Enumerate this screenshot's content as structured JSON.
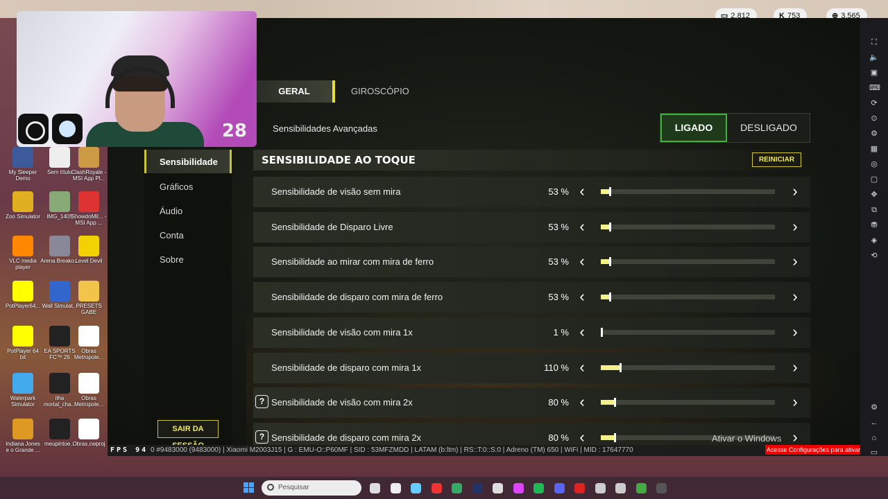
{
  "top_stats": [
    {
      "icon": "chat-icon",
      "value": "2.812"
    },
    {
      "icon": "kick-icon",
      "value": "753"
    },
    {
      "icon": "globe-icon",
      "value": "3.565"
    }
  ],
  "webcam": {
    "overlay_number": "28"
  },
  "desktop_icons": [
    {
      "label": "My Sleeper Demo"
    },
    {
      "label": "Sem título"
    },
    {
      "label": "ClashRoyale - MSI App Pl..."
    },
    {
      "label": "Zoo Simulator"
    },
    {
      "label": "IMG_1405"
    },
    {
      "label": "ShowdoMil... - MSI App ..."
    },
    {
      "label": "VLC media player"
    },
    {
      "label": "Arena Breako..."
    },
    {
      "label": "Level Devil"
    },
    {
      "label": "PotPlayer64..."
    },
    {
      "label": "Wall Simulat..."
    },
    {
      "label": "PRESETS GABE"
    },
    {
      "label": "PotPlayer 64 bit"
    },
    {
      "label": "EA SPORTS FC™ 26"
    },
    {
      "label": "Obras Metropole..."
    },
    {
      "label": "Waterpark Simulator"
    },
    {
      "label": "ilha mortal_cha..."
    },
    {
      "label": "Obras Metropole..."
    },
    {
      "label": "Indiana Jones e o Grande ..."
    },
    {
      "label": "meupintoe..."
    },
    {
      "label": "Obras.cwproj"
    }
  ],
  "tabs": {
    "active": "GERAL",
    "other": "GIROSCÓPIO"
  },
  "advanced": {
    "label": "Sensibilidades Avançadas",
    "on": "LIGADO",
    "off": "DESLIGADO"
  },
  "menu": {
    "items": [
      "Sensibilidade",
      "Gráficos",
      "Áudio",
      "Conta",
      "Sobre"
    ],
    "logout": "SAIR DA SESSÃO"
  },
  "section": {
    "title": "SENSIBILIDADE AO TOQUE",
    "reset": "REINICIAR"
  },
  "sensitivities": [
    {
      "label": "Sensibilidade de visão sem mira",
      "value": "53 %",
      "level": 0.05,
      "help": false
    },
    {
      "label": "Sensibilidade de Disparo Livre",
      "value": "53 %",
      "level": 0.05,
      "help": false
    },
    {
      "label": "Sensibilidade ao mirar com mira de ferro",
      "value": "53 %",
      "level": 0.05,
      "help": false
    },
    {
      "label": "Sensibilidade de disparo com mira de ferro",
      "value": "53 %",
      "level": 0.05,
      "help": false
    },
    {
      "label": "Sensibilidade de visão com mira 1x",
      "value": "1 %",
      "level": 0.0,
      "help": false
    },
    {
      "label": "Sensibilidade de disparo com mira 1x",
      "value": "110 %",
      "level": 0.11,
      "help": false
    },
    {
      "label": "Sensibilidade de visão com mira 2x",
      "value": "80 %",
      "level": 0.08,
      "help": true
    },
    {
      "label": "Sensibilidade de disparo com mira 2x",
      "value": "80 %",
      "level": 0.08,
      "help": true
    }
  ],
  "statusbar": {
    "fps_label": "FPS",
    "fps_value": "94",
    "info": "0 #9483000 (9483000) | Xiaomi M2003J15 | G : EMU-O::P60MF | SID : 53MFZMDD | LATAM (b:ltm) | RS::T:0::S:0 | Adreno (TM) 650 | WiFi | MID : 17647770"
  },
  "windows_activation": {
    "title": "Ativar o Windows",
    "subtitle": "Acesse Configurações para ativar o Windows."
  },
  "taskbar": {
    "search_placeholder": "Pesquisar"
  },
  "colors": {
    "accent_yellow": "#e6dc3a",
    "toggle_green": "#3fb23a",
    "slider_fill": "#f4f08a"
  }
}
